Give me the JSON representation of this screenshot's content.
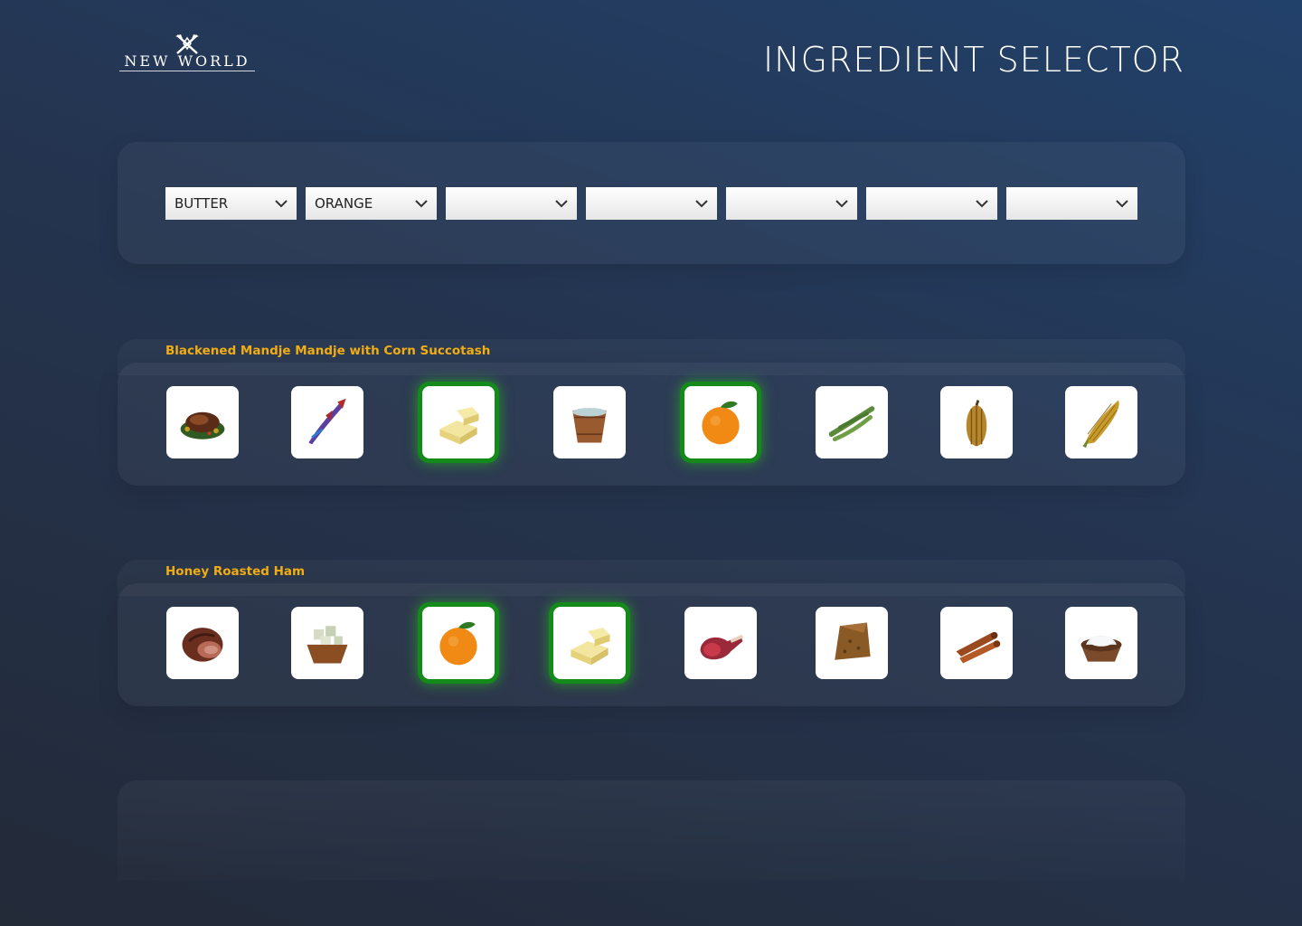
{
  "brand": {
    "logo_text": "NEW WORLD"
  },
  "page": {
    "title": "INGREDIENT SELECTOR"
  },
  "selectors": [
    {
      "value": "BUTTER"
    },
    {
      "value": "ORANGE"
    },
    {
      "value": ""
    },
    {
      "value": ""
    },
    {
      "value": ""
    },
    {
      "value": ""
    },
    {
      "value": ""
    }
  ],
  "recipes": [
    {
      "title": "Blackened Mandje Mandje with Corn Succotash",
      "ingredients": [
        {
          "icon": "roasted-fish-dish-icon",
          "highlighted": false
        },
        {
          "icon": "mandje-fish-icon",
          "highlighted": false
        },
        {
          "icon": "butter-icon",
          "highlighted": true
        },
        {
          "icon": "water-bucket-icon",
          "highlighted": false
        },
        {
          "icon": "orange-icon",
          "highlighted": true
        },
        {
          "icon": "green-beans-icon",
          "highlighted": false
        },
        {
          "icon": "squash-icon",
          "highlighted": false
        },
        {
          "icon": "corn-icon",
          "highlighted": false
        }
      ]
    },
    {
      "title": "Honey Roasted Ham",
      "ingredients": [
        {
          "icon": "roasted-ham-icon",
          "highlighted": false
        },
        {
          "icon": "honey-bowl-icon",
          "highlighted": false
        },
        {
          "icon": "orange-icon",
          "highlighted": true
        },
        {
          "icon": "butter-icon",
          "highlighted": true
        },
        {
          "icon": "raw-ham-icon",
          "highlighted": false
        },
        {
          "icon": "brown-sugar-icon",
          "highlighted": false
        },
        {
          "icon": "cinnamon-sticks-icon",
          "highlighted": false
        },
        {
          "icon": "salt-bowl-icon",
          "highlighted": false
        }
      ]
    }
  ],
  "colors": {
    "accent_title": "#f1ad12",
    "match_glow": "#138a1a"
  }
}
